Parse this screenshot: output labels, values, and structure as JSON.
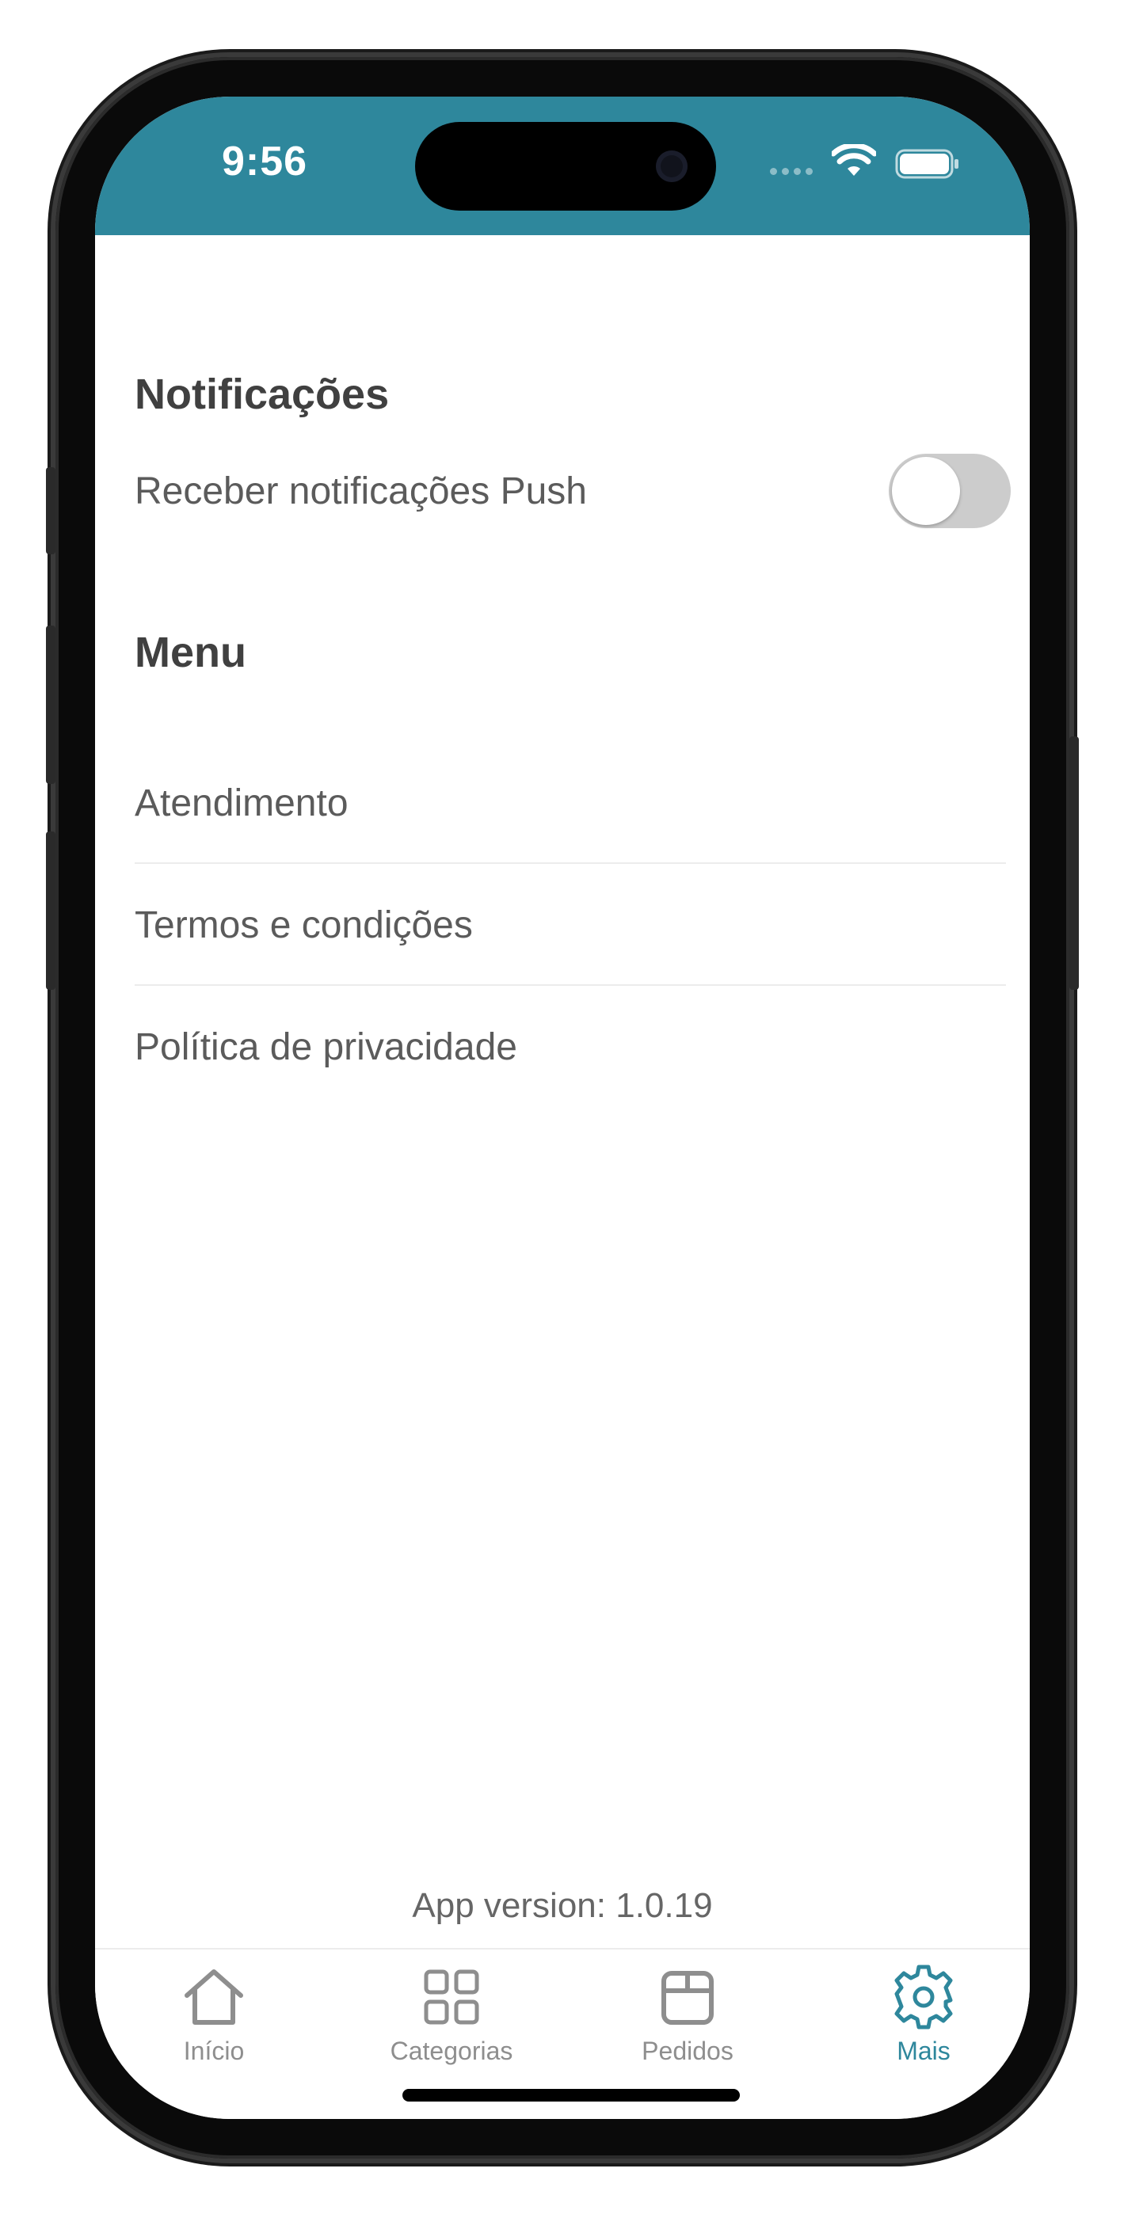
{
  "status_bar": {
    "time": "9:56",
    "background": "#2e879c",
    "icons": [
      "cellular-dots-icon",
      "wifi-icon",
      "battery-icon"
    ]
  },
  "notifications": {
    "title": "Notificações",
    "push_label": "Receber notificações Push",
    "push_enabled": false
  },
  "menu": {
    "title": "Menu",
    "items": [
      {
        "label": "Atendimento"
      },
      {
        "label": "Termos e condições"
      },
      {
        "label": "Política de privacidade"
      }
    ]
  },
  "footer": {
    "app_version": "App version: 1.0.19"
  },
  "tab_bar": {
    "accent_color": "#2e879c",
    "inactive_color": "#8e8e8e",
    "tabs": [
      {
        "label": "Início",
        "icon": "home-icon",
        "active": false
      },
      {
        "label": "Categorias",
        "icon": "grid-icon",
        "active": false
      },
      {
        "label": "Pedidos",
        "icon": "box-icon",
        "active": false
      },
      {
        "label": "Mais",
        "icon": "gear-icon",
        "active": true
      }
    ]
  }
}
